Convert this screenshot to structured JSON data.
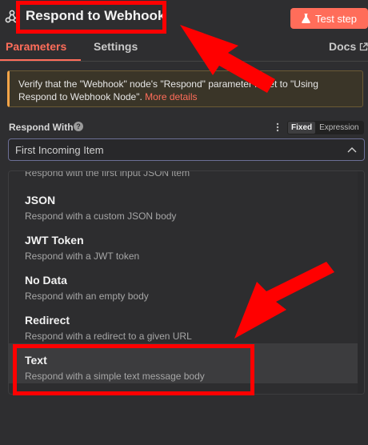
{
  "header": {
    "icon": "webhook-icon",
    "title": "Respond to Webhook",
    "test_button": {
      "label": "Test step",
      "icon": "flask-icon"
    }
  },
  "tabs": [
    {
      "label": "Parameters",
      "active": true
    },
    {
      "label": "Settings",
      "active": false
    },
    {
      "label": "Docs",
      "icon": "external-link-icon",
      "active": false
    }
  ],
  "notice": {
    "text": "Verify that the \"Webhook\" node's \"Respond\" parameter is set to \"Using Respond to Webhook Node\".",
    "link": "More details"
  },
  "field": {
    "label": "Respond With",
    "help_icon": "question-icon",
    "mode": {
      "fixed": "Fixed",
      "expression": "Expression",
      "selected": "Fixed"
    },
    "value": "First Incoming Item"
  },
  "dropdown": {
    "partial_description": "Respond with the first input JSON item",
    "options": [
      {
        "title": "JSON",
        "description": "Respond with a custom JSON body"
      },
      {
        "title": "JWT Token",
        "description": "Respond with a JWT token"
      },
      {
        "title": "No Data",
        "description": "Respond with an empty body"
      },
      {
        "title": "Redirect",
        "description": "Respond with a redirect to a given URL"
      },
      {
        "title": "Text",
        "description": "Respond with a simple text message body",
        "hovered": true
      }
    ]
  },
  "colors": {
    "accent": "#ff6d5a",
    "annotation": "#ff0000",
    "background": "#2e2e30",
    "notice_border": "#f2a348"
  }
}
